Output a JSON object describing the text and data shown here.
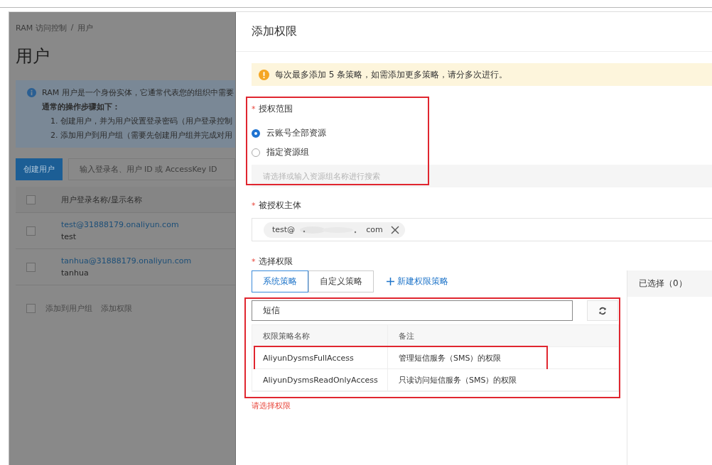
{
  "background_page": {
    "breadcrumb": {
      "items": [
        "RAM 访问控制",
        "用户"
      ],
      "separator": "/"
    },
    "title": "用户",
    "info": {
      "text": "RAM 用户是一个身份实体，它通常代表您的组织中需要",
      "steps_title": "通常的操作步骤如下：",
      "steps": [
        "1. 创建用户，并为用户设置登录密码（用户登录控制",
        "2. 添加用户到用户组（需要先创建用户组并完成对用"
      ]
    },
    "create_button": "创建用户",
    "search": {
      "placeholder": "输入登录名、用户 ID 或 AccessKey ID"
    },
    "table": {
      "columns": [
        "用户登录名称/显示名称"
      ],
      "header_checked": false,
      "rows": [
        {
          "login": "test@31888179.onaliyun.com",
          "display": "test",
          "checked": false
        },
        {
          "login": "tanhua@31888179.onaliyun.com",
          "display": "tanhua",
          "checked": false
        }
      ]
    },
    "footer": {
      "checked": false,
      "actions": [
        "添加到用户组",
        "添加权限"
      ]
    }
  },
  "drawer": {
    "title": "添加权限",
    "alert": "每次最多添加 5 条策略，如需添加更多策略，请分多次进行。",
    "scope": {
      "label": "授权范围",
      "required_mark": "*",
      "options": [
        {
          "label": "云账号全部资源",
          "selected": true
        },
        {
          "label": "指定资源组",
          "selected": false
        }
      ],
      "resource_group": {
        "placeholder": "请选择或输入资源组名称进行搜索"
      }
    },
    "principal": {
      "label": "被授权主体",
      "required_mark": "*",
      "tag": {
        "prefix": "test@",
        "suffix": "com"
      }
    },
    "permissions": {
      "label": "选择权限",
      "required_mark": "*",
      "tabs": [
        {
          "label": "系统策略",
          "selected": true
        },
        {
          "label": "自定义策略",
          "selected": false
        }
      ],
      "new_policy_link": "新建权限策略",
      "search": {
        "value": "短信"
      },
      "table": {
        "columns": [
          "权限策略名称",
          "备注"
        ],
        "rows": [
          {
            "name": "AliyunDysmsFullAccess",
            "note": "管理短信服务（SMS）的权限"
          },
          {
            "name": "AliyunDysmsReadOnlyAccess",
            "note": "只读访问短信服务（SMS）的权限"
          }
        ]
      },
      "error": "请选择权限",
      "selected_panel": {
        "title": "已选择（0）"
      }
    }
  }
}
